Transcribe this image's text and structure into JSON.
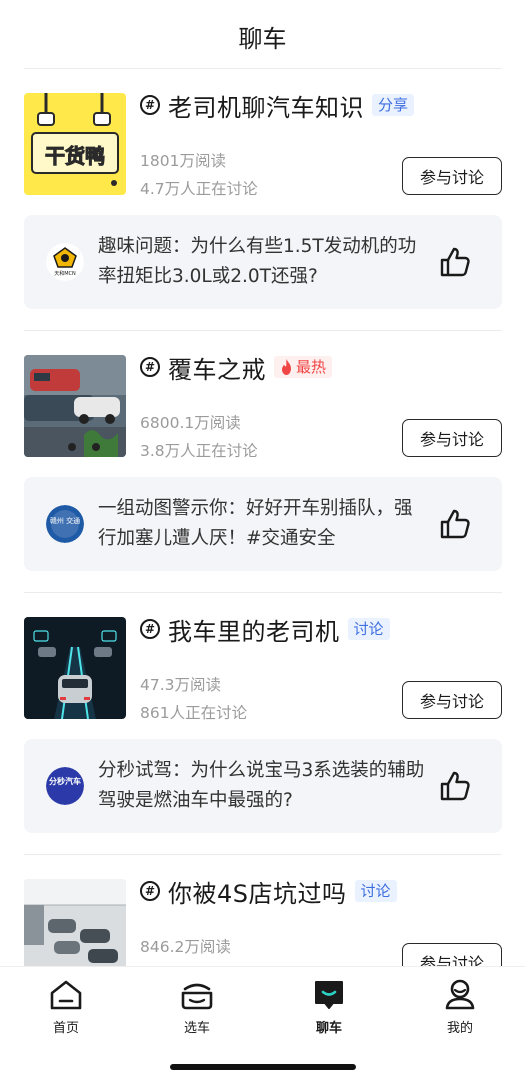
{
  "header": {
    "title": "聊车"
  },
  "topics": [
    {
      "title": "老司机聊汽车知识",
      "tag": "分享",
      "reads": "1801万阅读",
      "discussing": "4.7万人正在讨论",
      "join_label": "参与讨论",
      "thumb_text": "干货鸭",
      "post": {
        "avatar_text": "天和MCN",
        "text": "趣味问题：为什么有些1.5T发动机的功率扭矩比3.0L或2.0T还强?"
      }
    },
    {
      "title": "覆车之戒",
      "tag": "最热",
      "reads": "6800.1万阅读",
      "discussing": "3.8万人正在讨论",
      "join_label": "参与讨论",
      "post": {
        "avatar_text": "赣州 交通",
        "text": "一组动图警示你：好好开车别插队，强行加塞儿遭人厌！#交通安全"
      }
    },
    {
      "title": "我车里的老司机",
      "tag": "讨论",
      "reads": "47.3万阅读",
      "discussing": "861人正在讨论",
      "join_label": "参与讨论",
      "post": {
        "avatar_text": "分秒汽车",
        "text": "分秒试驾：为什么说宝马3系选装的辅助驾驶是燃油车中最强的?"
      }
    },
    {
      "title": "你被4S店坑过吗",
      "tag": "讨论",
      "reads": "846.2万阅读",
      "discussing": "",
      "join_label": "参与讨论"
    }
  ],
  "tabbar": [
    {
      "label": "首页",
      "icon": "home-icon"
    },
    {
      "label": "选车",
      "icon": "car-icon"
    },
    {
      "label": "聊车",
      "icon": "chat-icon",
      "active": true
    },
    {
      "label": "我的",
      "icon": "profile-icon"
    }
  ],
  "colors": {
    "accent_blue": "#3d6fe0",
    "hot_red": "#f04646",
    "muted_text": "#9b9b9b",
    "card_bg": "#f4f5f8",
    "active_tab_accent": "#2ad1c4"
  }
}
